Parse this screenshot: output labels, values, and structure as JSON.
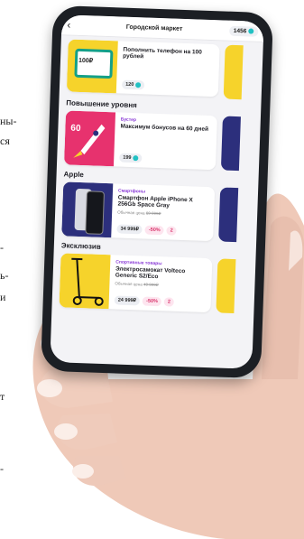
{
  "edge_text": [
    "ны-",
    "ся",
    "-",
    "ь-",
    "и",
    "т",
    "-"
  ],
  "screen": {
    "header": {
      "back_icon": "chevron-left-icon",
      "title": "Городской маркет",
      "balance": "1456"
    },
    "top_card": {
      "name": "Пополнить телефон на 100 рублей",
      "img_label": "100₽",
      "price": "120"
    },
    "sections": [
      {
        "title": "Повышение уровня",
        "card": {
          "category": "Бустер",
          "name": "Максимум бонусов на 60 дней",
          "img_label": "60",
          "price": "199"
        }
      },
      {
        "title": "Apple",
        "card": {
          "category": "Смартфоны",
          "name": "Смартфон Apple iPhone X 256Gb Space Gray",
          "old_label": "Обычная цена",
          "old_price": "69 999₽",
          "price": "34 999₽",
          "discount": "-50%",
          "extra": "2"
        }
      },
      {
        "title": "Эксклюзив",
        "card": {
          "category": "Спортивные товары",
          "name": "Электросамокат Volteco Generic S2/Eco",
          "old_label": "Обычная цена",
          "old_price": "49 999₽",
          "price": "24 999₽",
          "discount": "-50%",
          "extra": "2"
        }
      }
    ]
  },
  "colors": {
    "accent": "#8a3bd6",
    "coin": "#22c1c3",
    "yellow": "#f6d32b",
    "pink": "#e7326e",
    "navy": "#2c2f7c"
  }
}
